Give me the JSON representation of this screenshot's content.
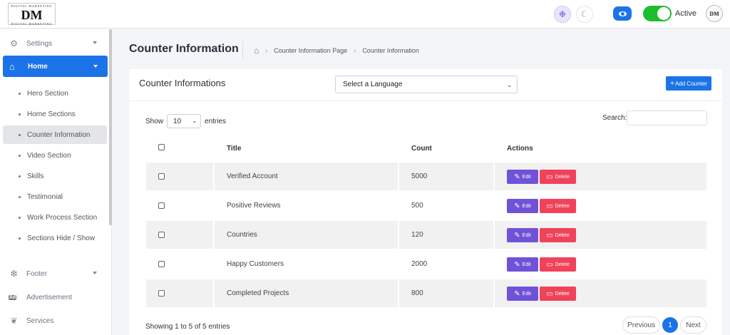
{
  "header": {
    "logo_line_top": "DIGITAL MARKETING",
    "logo_mark": "DM",
    "logo_line_bottom": "DIGITAL MARKETING",
    "status_label": "Active",
    "avatar_text": "DM"
  },
  "sidebar": {
    "settings": "Settings",
    "home": "Home",
    "sub_items": [
      "Hero Section",
      "Home Sections",
      "Counter Information",
      "Video Section",
      "Skills",
      "Testimonial",
      "Work Process Section",
      "Sections Hide / Show"
    ],
    "footer": "Footer",
    "advertisement": "Advertisement",
    "services": "Services"
  },
  "page": {
    "title": "Counter Information",
    "breadcrumb": [
      "Counter Information Page",
      "Counter Information"
    ]
  },
  "card": {
    "title": "Counter Informations",
    "language_select": "Select a Language",
    "add_button": "Add Counter",
    "show_label": "Show",
    "entries_value": "10",
    "entries_label": "entries",
    "search_label": "Search:",
    "search_value": "",
    "columns": [
      "Title",
      "Count",
      "Actions"
    ],
    "rows": [
      {
        "title": "Verified Account",
        "count": "5000"
      },
      {
        "title": "Positive Reviews",
        "count": "500"
      },
      {
        "title": "Countries",
        "count": "120"
      },
      {
        "title": "Happy Customers",
        "count": "2000"
      },
      {
        "title": "Completed Projects",
        "count": "800"
      }
    ],
    "edit_label": "Edit",
    "delete_label": "Delete",
    "footer_info": "Showing 1 to 5 of 5 entries",
    "prev": "Previous",
    "page": "1",
    "next": "Next"
  },
  "colors": {
    "primary": "#1c73e8",
    "edit": "#6f52d8",
    "delete": "#f0435a",
    "toggle": "#1fbd2c"
  }
}
